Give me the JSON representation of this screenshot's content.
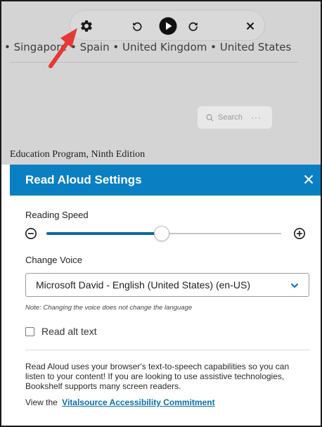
{
  "background": {
    "countries_text": "• Singapore • Spain • United Kingdom • United States",
    "edition_text": "Education Program, Ninth Edition",
    "search_placeholder": "Search",
    "search_more": "···"
  },
  "toolbar": {
    "icons": [
      "gear-icon",
      "rewind-icon",
      "play-icon",
      "forward-icon",
      "close-icon"
    ]
  },
  "panel": {
    "title": "Read Aloud Settings",
    "reading_speed": {
      "label": "Reading Speed",
      "value_fraction": 0.49
    },
    "voice": {
      "label": "Change Voice",
      "selected": "Microsoft David - English (United States) (en-US)",
      "note": "Note: Changing the voice does not change the language"
    },
    "alt_text": {
      "label": "Read alt text",
      "checked": false
    },
    "info_text": "Read Aloud uses your browser's text-to-speech capabilities so you can listen to your content! If you are looking to use assistive technologies, Bookshelf supports many screen readers.",
    "commitment": {
      "prefix": "View the",
      "link_text": "Vitalsource Accessibility Commitment"
    }
  },
  "colors": {
    "header_blue": "#0a7fc2",
    "slider_fill": "#0d6a9a",
    "link": "#0a6fa8",
    "annotation_arrow": "#e53935"
  }
}
